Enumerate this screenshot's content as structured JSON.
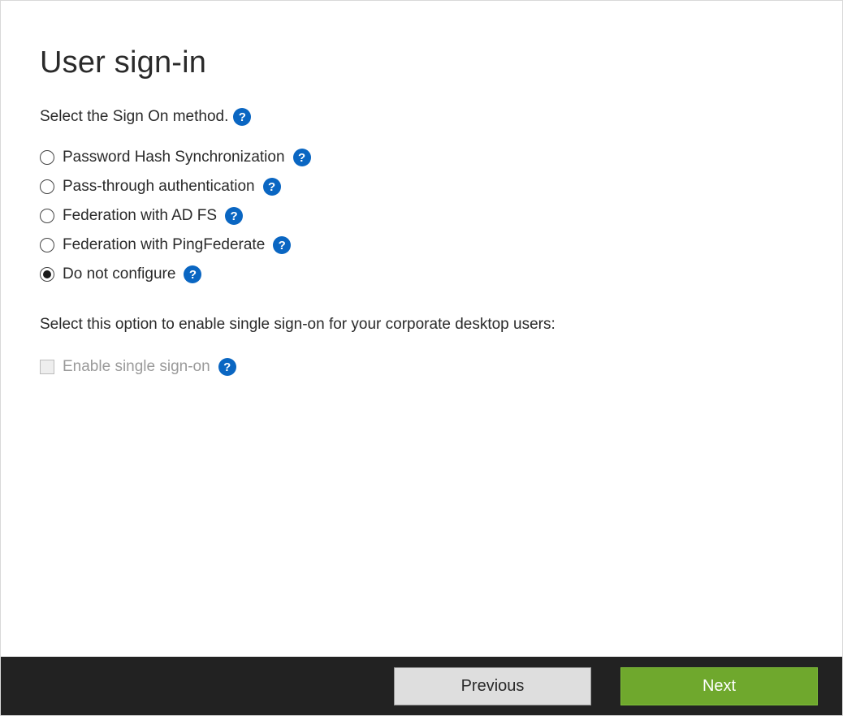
{
  "title": "User sign-in",
  "instruction": "Select the Sign On method.",
  "options": [
    {
      "label": "Password Hash Synchronization",
      "selected": false
    },
    {
      "label": "Pass-through authentication",
      "selected": false
    },
    {
      "label": "Federation with AD FS",
      "selected": false
    },
    {
      "label": "Federation with PingFederate",
      "selected": false
    },
    {
      "label": "Do not configure",
      "selected": true
    }
  ],
  "sso_instruction": "Select this option to enable single sign-on for your corporate desktop users:",
  "sso_checkbox": {
    "label": "Enable single sign-on",
    "checked": false,
    "disabled": true
  },
  "footer": {
    "previous": "Previous",
    "next": "Next"
  },
  "help_glyph": "?"
}
